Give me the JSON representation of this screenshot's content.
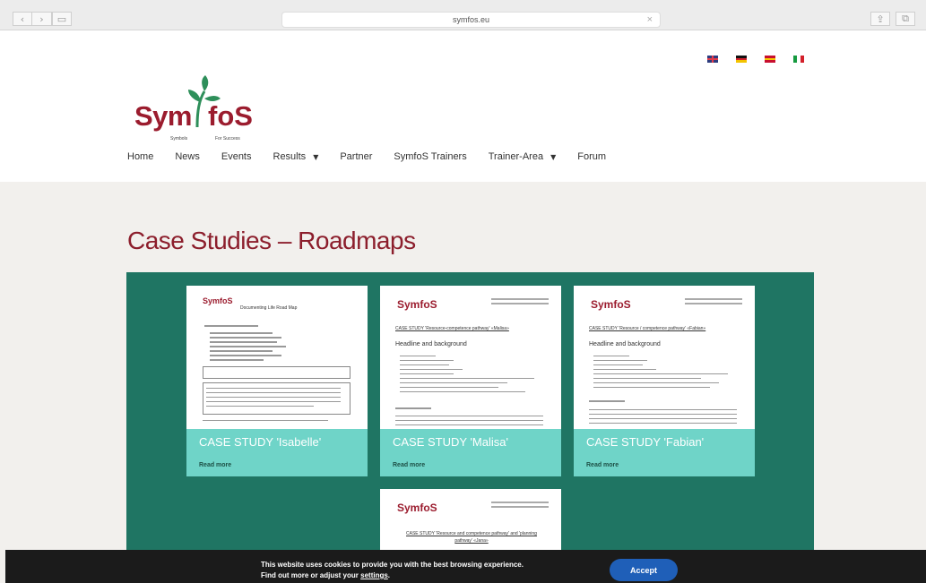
{
  "browser": {
    "url": "symfos.eu"
  },
  "logo": {
    "part1": "Sym",
    "part2": "foS",
    "sub1": "Symbols",
    "sub2": "For Success"
  },
  "languages": [
    "English",
    "Deutsch",
    "Español",
    "Italiano"
  ],
  "menu": [
    {
      "label": "Home",
      "has_dropdown": false
    },
    {
      "label": "News",
      "has_dropdown": false
    },
    {
      "label": "Events",
      "has_dropdown": false
    },
    {
      "label": "Results",
      "has_dropdown": true
    },
    {
      "label": "Partner",
      "has_dropdown": false
    },
    {
      "label": "SymfoS Trainers",
      "has_dropdown": false
    },
    {
      "label": "Trainer-Area",
      "has_dropdown": true
    },
    {
      "label": "Forum",
      "has_dropdown": false
    }
  ],
  "page_title": "Case Studies – Roadmaps",
  "cards": [
    {
      "title": "CASE STUDY 'Isabelle'",
      "read_more": "Read more",
      "doc_heading": "Documenting Life Road Map"
    },
    {
      "title": "CASE STUDY 'Malisa'",
      "read_more": "Read more",
      "doc_subtitle": "CASE STUDY 'Resource-competence pathway' «Malisa»",
      "doc_heading": "Headline and background"
    },
    {
      "title": "CASE STUDY 'Fabian'",
      "read_more": "Read more",
      "doc_subtitle": "CASE STUDY 'Resource / competence pathway' «Fabian»",
      "doc_heading": "Headline and background"
    },
    {
      "doc_subtitle": "CASE STUDY 'Resource and competence pathway' and 'planning pathway' «Jana»"
    }
  ],
  "cookie": {
    "line1": "This website uses cookies to provide you with the best browsing experience.",
    "line2_prefix": "Find out more or adjust your ",
    "line2_link": "settings",
    "line2_suffix": ".",
    "accept": "Accept"
  },
  "colors": {
    "brand": "#9b1c2e",
    "teal_panel": "#1f7563",
    "card_info": "#6fd4c8",
    "accept_button": "#1f5fb8"
  }
}
